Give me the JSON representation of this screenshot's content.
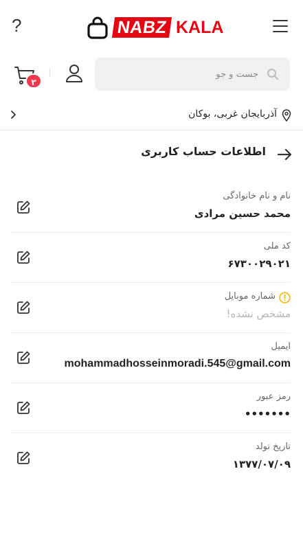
{
  "header": {
    "help_icon": "?",
    "logo_part1": "NABZ",
    "logo_part2": "KALA",
    "brand_color": "#e30613"
  },
  "search": {
    "placeholder": "جست و جو",
    "cart_count": "۳"
  },
  "location": {
    "text": "آذربایجان غربی، بوکان"
  },
  "page": {
    "title": "اطلاعات حساب کاربری"
  },
  "fields": [
    {
      "label": "نام و نام خانوادگی",
      "value": "محمد حسین مرادی"
    },
    {
      "label": "کد ملی",
      "value": "۶۷۳۰۰۲۹۰۲۱"
    },
    {
      "label": "شماره موبایل",
      "value": "مشخص نشده!"
    },
    {
      "label": "ایمیل",
      "value": "mohammadhosseinmoradi.545@gmail.com"
    },
    {
      "label": "رمز عبور",
      "value": "•••••••"
    },
    {
      "label": "تاریخ تولد",
      "value": "۱۳۷۷/۰۷/۰۹"
    }
  ]
}
